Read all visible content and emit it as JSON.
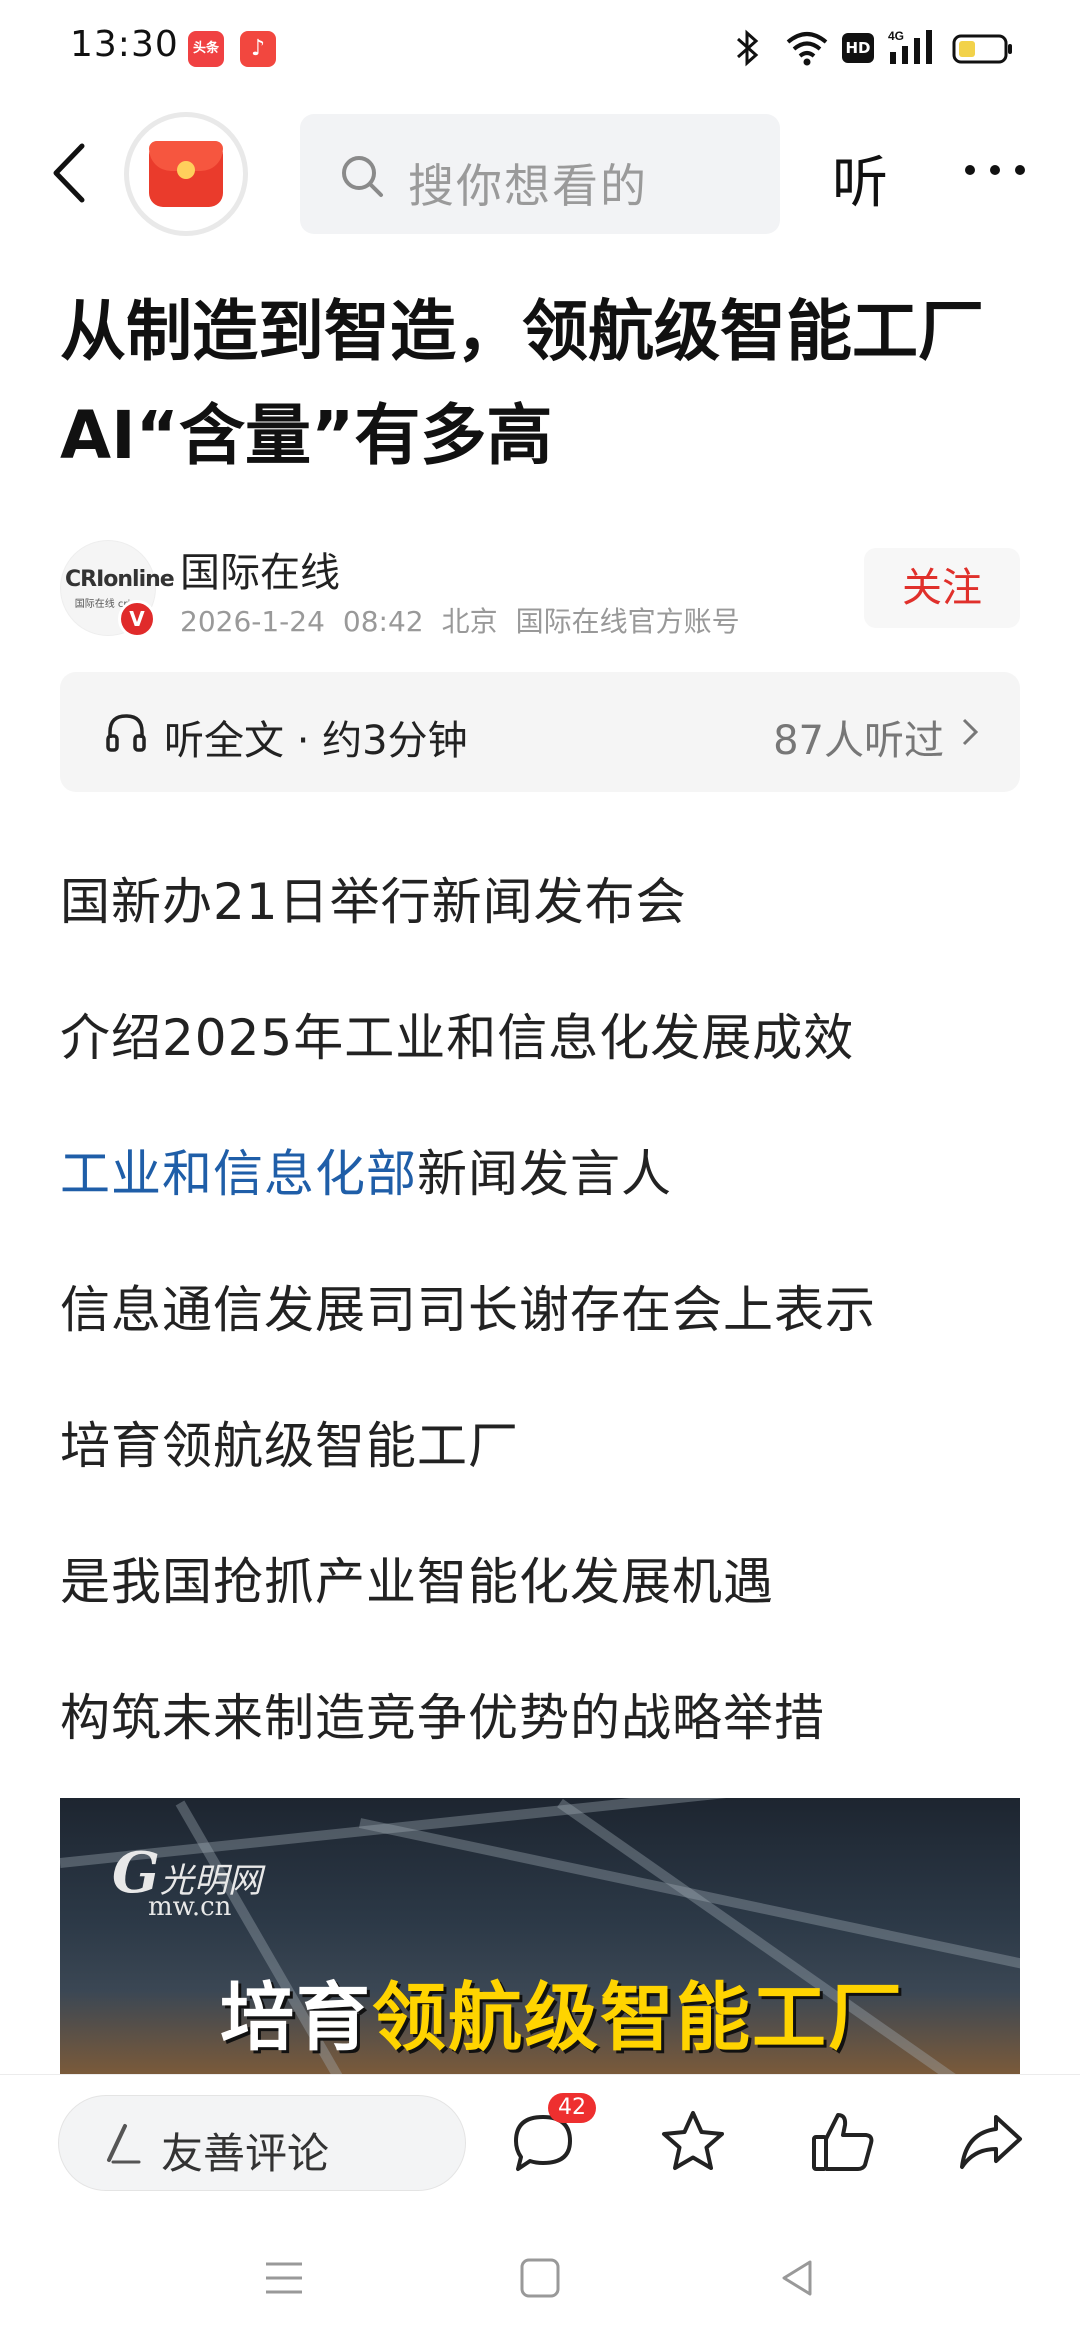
{
  "status_bar": {
    "time": "13:30",
    "app_toutiao_label": "头条",
    "hd_label": "HD",
    "network": "4G"
  },
  "top_bar": {
    "search_placeholder": "搜你想看的",
    "listen_label": "听"
  },
  "article": {
    "title_line1": "从制造到智造，领航级智能工厂",
    "title_line2": "AI“含量”有多高",
    "author": {
      "name": "国际在线",
      "logo_text": "CRIonline",
      "logo_sub": "国际在线 cri.cn",
      "verified_label": "V",
      "date": "2026-1-24",
      "time": "08:42",
      "location": "北京",
      "account_type": "国际在线官方账号",
      "follow_label": "关注"
    },
    "listen_bar": {
      "label": "听全文 · 约3分钟",
      "count": "87人听过"
    },
    "body": {
      "line1": "国新办21日举行新闻发布会",
      "line2": "介绍2025年工业和信息化发展成效",
      "line3_link": "工业和信息化部",
      "line3_rest": "新闻发言人",
      "line4": "信息通信发展司司长谢存在会上表示",
      "line5": "培育领航级智能工厂",
      "line6": "是我国抢抓产业智能化发展机遇",
      "line7": "构筑未来制造竞争优势的战略举措"
    },
    "image": {
      "watermark_g": "G",
      "watermark_cn": "光明网",
      "watermark_site": "mw.cn",
      "caption_white": "培育",
      "caption_yellow": "领航级智能工厂"
    }
  },
  "bottom_bar": {
    "comment_placeholder": "友善评论",
    "comment_count": "42"
  },
  "colors": {
    "accent_red": "#e0302b",
    "link_blue": "#1f5ea8",
    "caption_yellow": "#ffd400"
  }
}
